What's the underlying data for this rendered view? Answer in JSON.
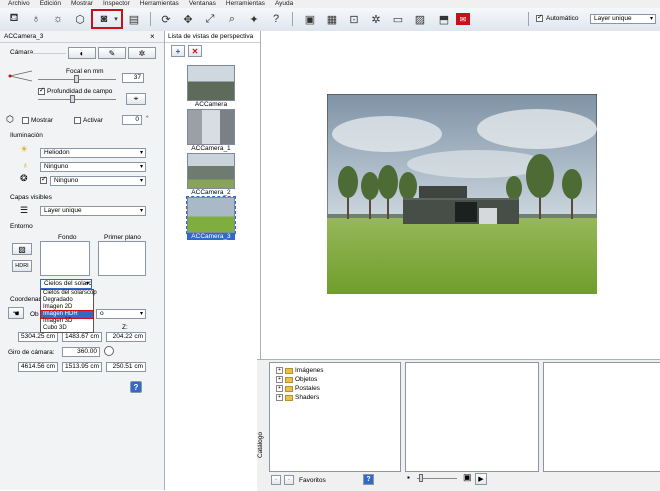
{
  "menu": [
    "Archivo",
    "Edición",
    "Mostrar",
    "Inspector",
    "Herramientas",
    "Ventanas",
    "Herramientas",
    "Ayuda"
  ],
  "toolbar": {
    "automatic_label": "Automático",
    "layer_combo": "Layer unique"
  },
  "left_panel": {
    "camera_name": "ACCamera_3",
    "camera_section": "Cámara",
    "focal_label": "Focal en mm",
    "focal_value": "37",
    "depth_label": "Profundidad de campo",
    "show_label": "Mostrar",
    "activate_label": "Activar",
    "zero_value": "0",
    "degree_symbol": "°",
    "lighting_section": "Iluminación",
    "heliodon_value": "Heliodon",
    "none1_value": "Ninguno",
    "none2_value": "Ninguno",
    "visible_layers_section": "Capas visibles",
    "layers_value": "Layer unique",
    "environment_section": "Entorno",
    "background_label": "Fondo",
    "foreground_label": "Primer plano",
    "hdri_label": "HDRI",
    "env_combo_value": "Cielos del solarc",
    "env_options": [
      "Cielos del solarscop",
      "Degradado",
      "Imagen 2D",
      "Imagen HDR",
      "Imagen 3D",
      "Cubo 3D"
    ],
    "env_selected_index": 3,
    "coords_section": "Coordenadas",
    "coords_combo_prefix": "Ob",
    "coords_combo_suffix": "o",
    "z_label": "Z:",
    "coord_x1": "5304.25 cm",
    "coord_y1": "1483.67 cm",
    "coord_z1": "204.22 cm",
    "rotation_label": "Giro de cámara:",
    "rotation_value": "360.00",
    "coord_x2": "4614.56 cm",
    "coord_y2": "1513.95 cm",
    "coord_z2": "250.51 cm",
    "help_label": "?"
  },
  "mid_panel": {
    "title": "Lista de vistas de perspectiva",
    "views": [
      {
        "label": "ACCamera",
        "selected": false
      },
      {
        "label": "ACCamera_1",
        "selected": false
      },
      {
        "label": "ACCamera_2",
        "selected": false
      },
      {
        "label": "ACCamera_3",
        "selected": true
      }
    ]
  },
  "catalog": {
    "side_label": "Catálogo",
    "tree": [
      "Imágenes",
      "Objetos",
      "Postales",
      "Shaders"
    ],
    "favorites_label": "Favoritos",
    "help_label": "?"
  },
  "colors": {
    "highlight": "#c8101a",
    "selection": "#3169c6",
    "sky": "#9fb4c6",
    "grass": "#7fae3f"
  }
}
